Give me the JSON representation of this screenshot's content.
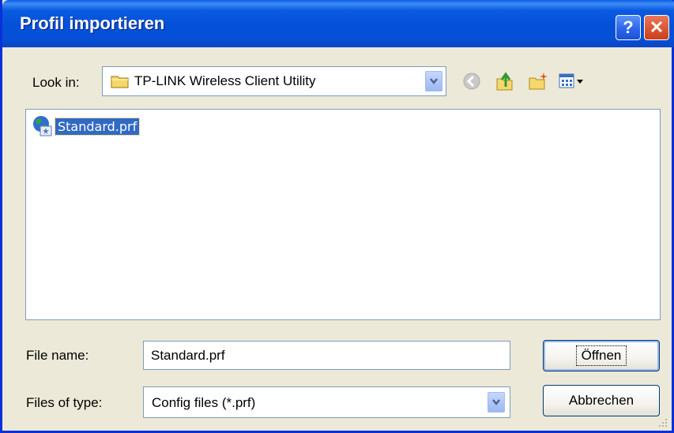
{
  "dialog": {
    "title": "Profil importieren",
    "help_label": "?",
    "close_label": "✕"
  },
  "look_in": {
    "label": "Look in:",
    "value": "TP-LINK Wireless Client Utility"
  },
  "files": [
    {
      "name": "Standard.prf",
      "selected": true
    }
  ],
  "file_name": {
    "label": "File name:",
    "value": "Standard.prf"
  },
  "file_type": {
    "label": "Files of type:",
    "value": "Config files (*.prf)"
  },
  "buttons": {
    "open": "Öffnen",
    "cancel": "Abbrechen"
  },
  "colors": {
    "title_bar": "#0a5ae0",
    "selection": "#316ac5",
    "dialog_bg": "#ece9d8"
  }
}
